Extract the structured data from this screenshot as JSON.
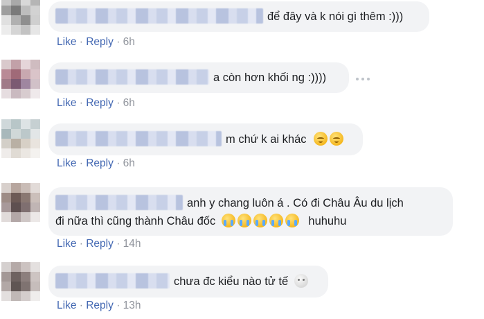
{
  "comments": [
    {
      "text": "để đây và k nói gì thêm :)))",
      "actions": {
        "like": "Like",
        "reply": "Reply",
        "time": "6h"
      }
    },
    {
      "text": "a còn hơn khối ng :))))",
      "actions": {
        "like": "Like",
        "reply": "Reply",
        "time": "6h"
      }
    },
    {
      "text": "m chứ k ai khác",
      "emojis": [
        "relieved-face-emoji",
        "relieved-face-emoji"
      ],
      "actions": {
        "like": "Like",
        "reply": "Reply",
        "time": "6h"
      }
    },
    {
      "text_line1": "anh y chang luôn á . Có đi Châu Âu du lịch",
      "text_line2": "đi nữa thì cũng thành Châu đốc",
      "emojis": [
        "loudly-crying-face-emoji",
        "loudly-crying-face-emoji",
        "loudly-crying-face-emoji",
        "loudly-crying-face-emoji",
        "loudly-crying-face-emoji"
      ],
      "text_after": "huhuhu",
      "actions": {
        "like": "Like",
        "reply": "Reply",
        "time": "14h"
      }
    },
    {
      "text": "chưa đc kiểu nào tử tế",
      "emojis": [
        "full-moon-face-emoji"
      ],
      "actions": {
        "like": "Like",
        "reply": "Reply",
        "time": "13h"
      }
    }
  ],
  "separator": "·",
  "colors": {
    "link": "#4267b2",
    "meta": "#90949c",
    "bubble": "#f2f3f5"
  }
}
